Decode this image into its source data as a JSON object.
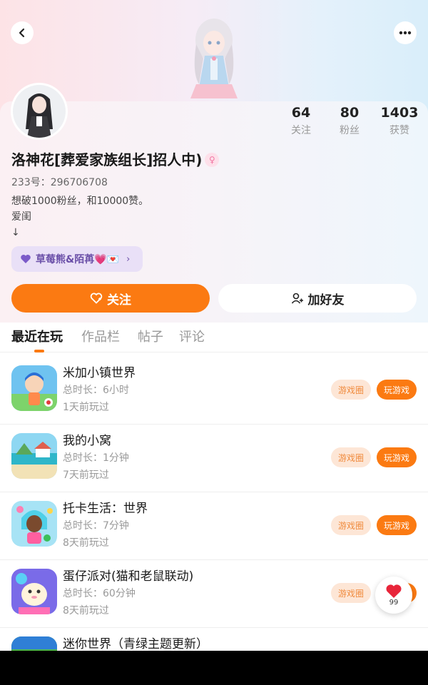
{
  "header": {
    "back_icon": "chevron-left-icon",
    "more_icon": "more-horizontal-icon"
  },
  "stats": [
    {
      "value": "64",
      "label": "关注"
    },
    {
      "value": "80",
      "label": "粉丝"
    },
    {
      "value": "1403",
      "label": "获赞"
    }
  ],
  "profile": {
    "name": "洛神花[葬爱家族组长]招人中)",
    "gender_icon": "female-icon",
    "uid": "233号：296706708",
    "bio_lines": [
      "想破1000粉丝，和10000赞。",
      "爱闺",
      "↓"
    ]
  },
  "family_tag": {
    "label": "草莓熊&陌苒💗💌",
    "icon": "purple-heart-icon"
  },
  "actions": {
    "follow_label": "关注",
    "add_friend_label": "加好友"
  },
  "tabs": [
    "最近在玩",
    "作品栏",
    "帖子",
    "评论"
  ],
  "games": [
    {
      "title": "米加小镇世界",
      "duration": "总时长：6小时",
      "last_played": "1天前玩过"
    },
    {
      "title": "我的小窝",
      "duration": "总时长：1分钟",
      "last_played": "7天前玩过"
    },
    {
      "title": "托卡生活：世界",
      "duration": "总时长：7分钟",
      "last_played": "8天前玩过"
    },
    {
      "title": "蛋仔派对(猫和老鼠联动)",
      "duration": "总时长：60分钟",
      "last_played": "8天前玩过"
    },
    {
      "title": "迷你世界（青绿主题更新）",
      "duration": "",
      "last_played": ""
    }
  ],
  "game_buttons": {
    "circle_label": "游戏圈",
    "play_label": "玩游戏"
  },
  "like_fab": {
    "count": "99"
  },
  "colors": {
    "accent": "#fb7a12",
    "tag_bg": "#e9e0f7"
  }
}
